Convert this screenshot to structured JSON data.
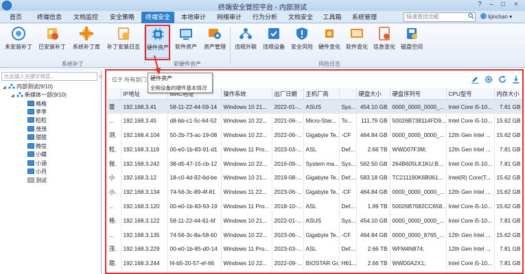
{
  "window": {
    "title": "终端安全管控平台 - 内部测试",
    "controls": [
      "?",
      "–",
      "□",
      "×"
    ]
  },
  "menu": {
    "tabs": [
      "首页",
      "终端信息",
      "文档监控",
      "安全策略",
      "终端安全",
      "本地审计",
      "网络审计",
      "行为分析",
      "文档安全",
      "工具箱",
      "系统管理"
    ],
    "active_index": 4,
    "search_placeholder": "快速查找功能",
    "user": "lijinchan"
  },
  "ribbon": {
    "buttons": [
      {
        "label": "未安装补丁",
        "icon": "patch-icon"
      },
      {
        "label": "已安装补丁",
        "icon": "patch-installed-icon"
      },
      {
        "label": "系统补丁库",
        "icon": "patch-library-icon"
      },
      {
        "label": "补丁安装日志",
        "icon": "patch-log-icon"
      },
      {
        "label": "硬件资产",
        "icon": "cpu-icon"
      },
      {
        "label": "软件资产",
        "icon": "software-icon"
      },
      {
        "label": "资产管理",
        "icon": "asset-manage-icon"
      },
      {
        "label": "违规外联",
        "icon": "network-icon"
      },
      {
        "label": "违规设备",
        "icon": "device-violation-icon"
      },
      {
        "label": "安全风险",
        "icon": "risk-icon"
      },
      {
        "label": "硬件变化",
        "icon": "hardware-change-icon"
      },
      {
        "label": "软件变化",
        "icon": "software-change-icon"
      },
      {
        "label": "信息变化",
        "icon": "info-change-icon"
      },
      {
        "label": "磁盘空间",
        "icon": "disk-icon"
      }
    ],
    "groups": [
      "系统补丁",
      "软硬件资产",
      "风险日志"
    ]
  },
  "tooltip": {
    "title": "硬件资产",
    "description": "全网设备的硬件基本情况"
  },
  "tree": {
    "filter_placeholder": "在此输入关键字筛选...",
    "root": "内部测试(9/10)",
    "child": "新媒体一部(9/10)",
    "members": [
      "格格",
      "李李",
      "粒粒",
      "茂茂",
      "甜甜",
      "微信",
      "小蝶",
      "小涵",
      "小月",
      "测试"
    ],
    "offline_members": [
      "测试"
    ]
  },
  "toolbar": {
    "position_label": "位于 所有部门"
  },
  "grid": {
    "columns": [
      "",
      "IP地址",
      "MAC地址",
      "操作系统",
      "出厂日期",
      "主机厂商",
      "",
      "硬盘大小",
      "硬盘序列号",
      "CPU型号",
      "内存大小"
    ],
    "rows": [
      [
        "蕾",
        "192.168.3.41",
        "58-11-22-44-59-14",
        "Windows 10 21...",
        "2022-01-...",
        "ASUS",
        "Sys...",
        "454.10 GB",
        "0000_0000_0000_...",
        "Intel Core i5-10...",
        "7.81 GB"
      ],
      [
        "...",
        "192.168.3.45",
        "d8-bb-c1-5c-64-52",
        "Windows 10 22...",
        "2021-06-...",
        "Micro-Star...",
        "To...",
        "111.79 GB",
        "50026B738114FD9...",
        "Intel Core i5-10...",
        "15.62 GB"
      ],
      [
        "测.",
        "192.168.4.104",
        "50-2b-73-ac-19-08",
        "Windows 10 22...",
        "2022-06-...",
        "Gigabyte Te...",
        "-CF",
        "464.84 GB",
        "0000_0000_0000_...",
        "12th Gen Intel ...",
        "15.62 GB"
      ],
      [
        "粒.",
        "192.168.3.119",
        "00-e0-1b-83-91-d1",
        "Windows 11 Pro...",
        "2023-03-...",
        "ASL",
        "Def...",
        "2.66 TB",
        "WWD07F3M;",
        "12th Gen Intel ...",
        "7.81 GB"
      ],
      [
        "微.",
        "192.168.3.242",
        "38-d5-47-15-cb-12",
        "Windows 10 22...",
        "2016-09-...",
        "System ma...",
        "Sys...",
        "562.50 GB",
        "264B605LK1KU;B...",
        "Intel Core i5-10...",
        "7.81 GB"
      ],
      [
        "小",
        "192.168.3.12",
        "18-c0-4d-92-6d-be",
        "Windows 10 21...",
        "2019-08-...",
        "Gigabyte Te...",
        "Def...",
        "583.18 GB",
        "TC211190K6B061...",
        "Intel(R) Core(T...",
        "15.62 GB"
      ],
      [
        "小.",
        "192.168.3.134",
        "74-56-3c-89-4f-81",
        "Windows 11 22...",
        "2023-06-...",
        "Gigabyte Te...",
        "-CF",
        "464.84 GB",
        "0000_0000_0000_...",
        "12th Gen Intel ...",
        "15.62 GB"
      ],
      [
        "...",
        "192.168.3.120",
        "00-e0-1b-83-93-19",
        "Windows 11 Pro...",
        "2018-10-...",
        "ASL",
        "Def...",
        "1.99 TB",
        "50026B7682CC658...",
        "Intel Core i5-10...",
        "15.62 GB"
      ],
      [
        "格.",
        "192.168.3.122",
        "58-11-22-44-61-6f",
        "Windows 10 21...",
        "2022-01-...",
        "ASUS",
        "Sys...",
        "454.10 GB",
        "0000_0000_0000_...",
        "Intel Core i5-10...",
        "7.81 GB"
      ],
      [
        "...",
        "192.168.3.135",
        "74-56-3c-8a-58-60",
        "Windows 10 22...",
        "2023-06-...",
        "Gigabyte Te...",
        "-CF",
        "464.84 GB",
        "0000_0000_8765_...",
        "12th Gen Intel ...",
        "15.62 GB"
      ],
      [
        "茂.",
        "192.168.3.229",
        "00-e0-1b-85-d0-14",
        "Windows 11 Pro...",
        "2023-03-...",
        "ASL",
        "Def...",
        "2.66 TB",
        "WFM4N874;",
        "12th Gen Intel ...",
        "7.81 GB"
      ],
      [
        "甜.",
        "192.168.3.244",
        "f4-b5-20-57-ef-66",
        "Windows 10 22...",
        "2022-09-...",
        "BIOSTAR Gr...",
        "H61...",
        "2.66 TB",
        "WWD0A2X1;",
        "Intel Core i5-10...",
        "7.81 GB"
      ]
    ]
  },
  "colors": {
    "accent": "#2f7fd1",
    "highlight": "#e42a2a"
  }
}
